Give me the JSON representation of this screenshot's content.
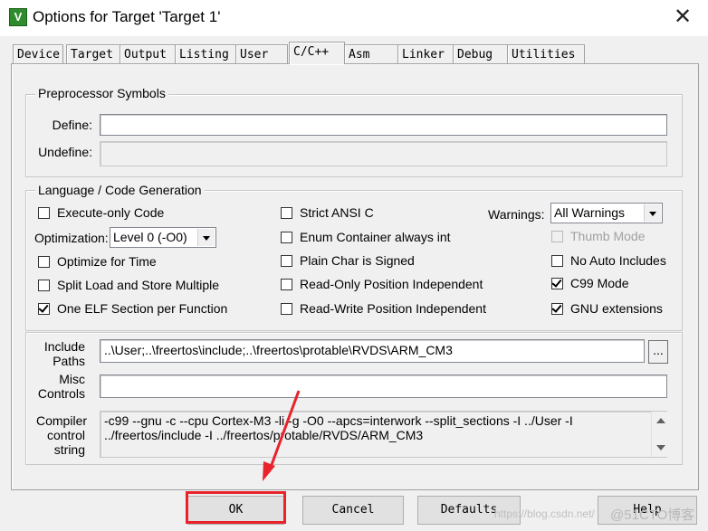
{
  "window": {
    "title": "Options for Target 'Target 1'",
    "close_glyph": "✕",
    "icon_glyph": "V"
  },
  "tabs": [
    {
      "label": "Device",
      "active": false
    },
    {
      "label": "Target",
      "active": false
    },
    {
      "label": "Output",
      "active": false
    },
    {
      "label": "Listing",
      "active": false
    },
    {
      "label": "User",
      "active": false
    },
    {
      "label": "C/C++",
      "active": true
    },
    {
      "label": "Asm",
      "active": false
    },
    {
      "label": "Linker",
      "active": false
    },
    {
      "label": "Debug",
      "active": false
    },
    {
      "label": "Utilities",
      "active": false
    }
  ],
  "preprocessor": {
    "legend": "Preprocessor Symbols",
    "define_label": "Define:",
    "define_value": "",
    "undefine_label": "Undefine:",
    "undefine_value": ""
  },
  "language": {
    "legend": "Language / Code Generation",
    "execute_only": {
      "label": "Execute-only Code",
      "checked": false
    },
    "optimization_label": "Optimization:",
    "optimization_value": "Level 0 (-O0)",
    "optimize_for_time": {
      "label": "Optimize for Time",
      "checked": false
    },
    "split_load_store": {
      "label": "Split Load and Store Multiple",
      "checked": false
    },
    "one_elf_section": {
      "label": "One ELF Section per Function",
      "checked": true
    },
    "strict_ansi": {
      "label": "Strict ANSI C",
      "checked": false
    },
    "enum_container": {
      "label": "Enum Container always int",
      "checked": false
    },
    "plain_char_signed": {
      "label": "Plain Char is Signed",
      "checked": false
    },
    "ro_position_independent": {
      "label": "Read-Only Position Independent",
      "checked": false
    },
    "rw_position_independent": {
      "label": "Read-Write Position Independent",
      "checked": false
    },
    "warnings_label": "Warnings:",
    "warnings_value": "All Warnings",
    "thumb_mode": {
      "label": "Thumb Mode",
      "checked": false,
      "disabled": true
    },
    "no_auto_includes": {
      "label": "No Auto Includes",
      "checked": false
    },
    "c99_mode": {
      "label": "C99 Mode",
      "checked": true
    },
    "gnu_extensions": {
      "label": "GNU extensions",
      "checked": true
    }
  },
  "paths": {
    "include_label_1": "Include",
    "include_label_2": "Paths",
    "include_value": "..\\User;..\\freertos\\include;..\\freertos\\protable\\RVDS\\ARM_CM3",
    "browse_label": "...",
    "misc_label_1": "Misc",
    "misc_label_2": "Controls",
    "misc_value": "",
    "compiler_label_1": "Compiler",
    "compiler_label_2": "control",
    "compiler_label_3": "string",
    "compiler_line_1": "-c99 --gnu -c --cpu Cortex-M3 -li -g -O0 --apcs=interwork --split_sections -I ../User -I",
    "compiler_line_2": "../freertos/include -I ../freertos/protable/RVDS/ARM_CM3"
  },
  "buttons": {
    "ok": "OK",
    "cancel": "Cancel",
    "defaults": "Defaults",
    "help": "Help"
  },
  "overlay": {
    "highlight_color": "#e8232b",
    "watermark": "https://blog.csdn.net/",
    "watermark_2": "@51CTO博客"
  }
}
